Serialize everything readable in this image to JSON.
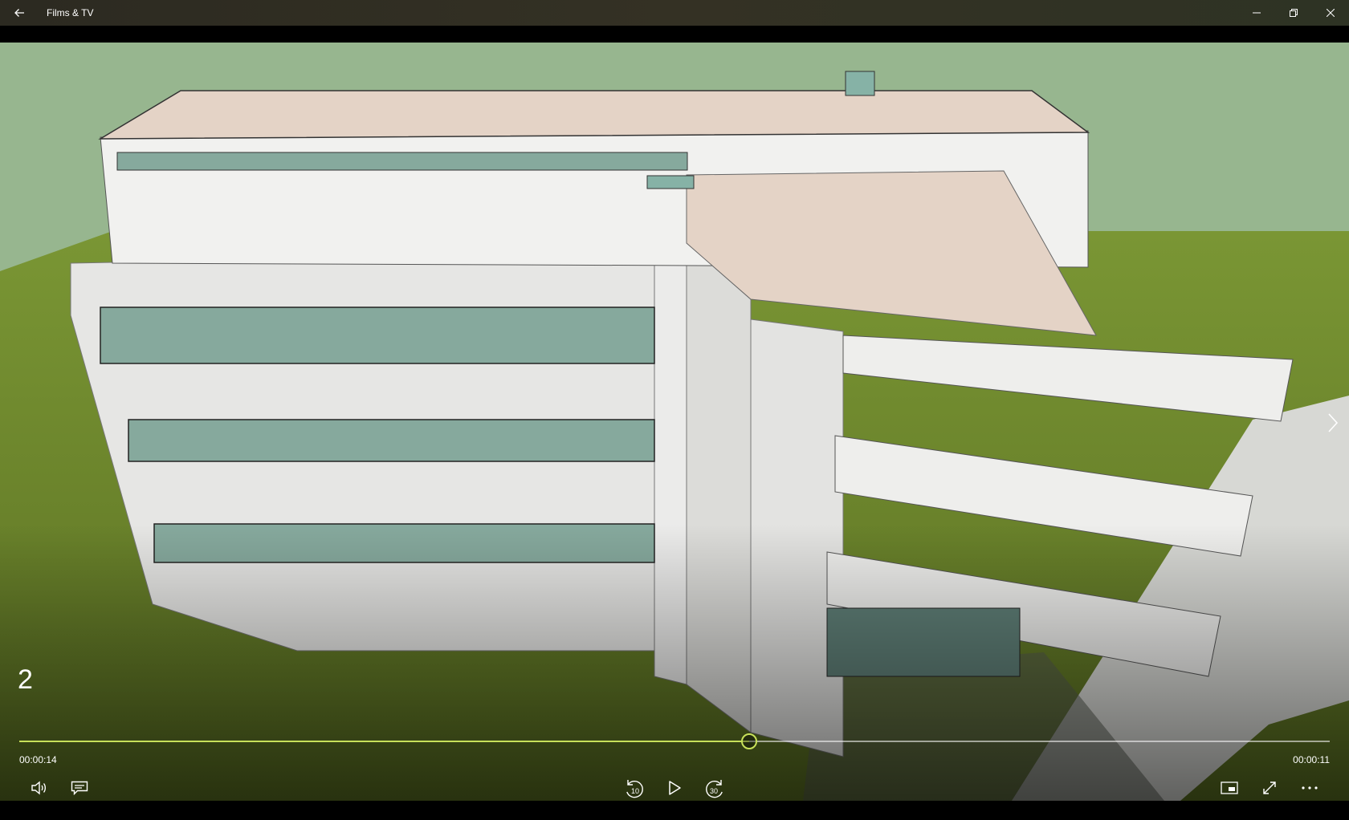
{
  "app": {
    "title": "Films & TV"
  },
  "player": {
    "chapter_number": "2",
    "elapsed": "00:00:14",
    "remaining": "00:00:11",
    "progress": 0.557,
    "skip_back_seconds": "10",
    "skip_forward_seconds": "30"
  },
  "icons": {
    "back": "back-arrow-icon",
    "minimize": "minimize-icon",
    "restore": "restore-icon",
    "close": "close-icon",
    "volume": "volume-icon",
    "captions": "captions-icon",
    "skip_back": "skip-back-10-icon",
    "play": "play-icon",
    "skip_forward": "skip-forward-30-icon",
    "mini_view": "mini-view-icon",
    "fullscreen": "fullscreen-icon",
    "more": "more-icon",
    "next": "chevron-right-icon"
  },
  "colors": {
    "accent": "#c8e15a",
    "sky": "#97b68f",
    "grass": "#6f8a2c",
    "roof": "#e4d3c6",
    "wall": "#e6e6e4",
    "glass": "#86a99d"
  }
}
